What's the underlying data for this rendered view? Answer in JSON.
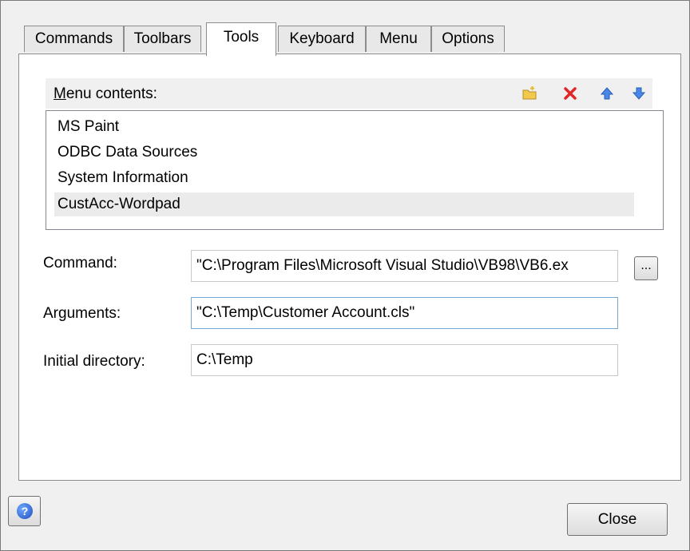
{
  "tabs": [
    {
      "label": "Commands"
    },
    {
      "label": "Toolbars"
    },
    {
      "label": "Tools",
      "active": true
    },
    {
      "label": "Keyboard"
    },
    {
      "label": "Menu"
    },
    {
      "label": "Options"
    }
  ],
  "menu_contents": {
    "label_prefix": "M",
    "label_rest": "enu contents:",
    "toolbar_icons": [
      "new-folder-icon",
      "delete-icon",
      "move-up-icon",
      "move-down-icon"
    ],
    "items": [
      {
        "label": "MS Paint"
      },
      {
        "label": "ODBC Data Sources"
      },
      {
        "label": "System Information"
      },
      {
        "label": "CustAcc-Wordpad",
        "selected": true
      }
    ]
  },
  "fields": {
    "command": {
      "label": "Command:",
      "value": "\"C:\\Program Files\\Microsoft Visual Studio\\VB98\\VB6.ex"
    },
    "arguments": {
      "label": "Arguments:",
      "value": "\"C:\\Temp\\Customer Account.cls\""
    },
    "initial_directory": {
      "label": "Initial directory:",
      "value": "C:\\Temp"
    }
  },
  "browse_button": {
    "label": "..."
  },
  "help_button": {
    "label": "?"
  },
  "close_button": {
    "label": "Close"
  }
}
